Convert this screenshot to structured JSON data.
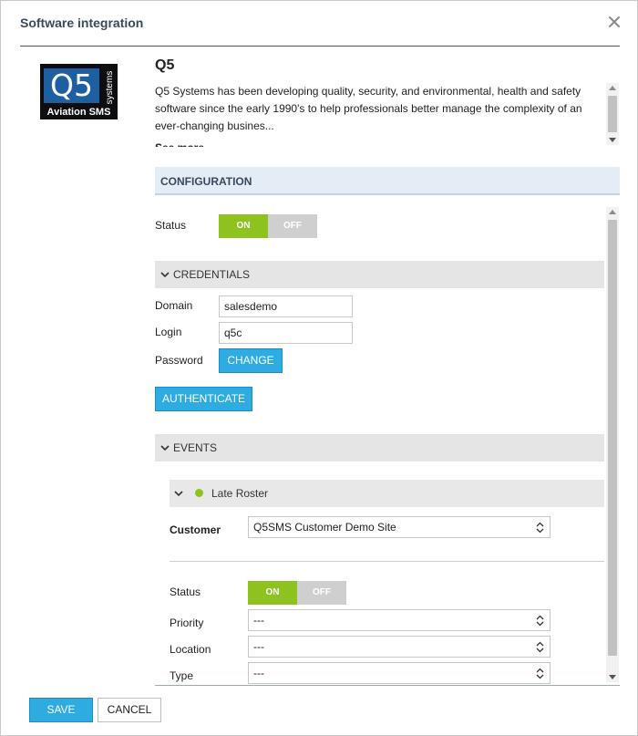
{
  "dialog": {
    "title": "Software integration"
  },
  "app": {
    "logo_text": "Q5",
    "logo_subtext": "systems",
    "logo_tagline": "Aviation SMS",
    "name": "Q5",
    "description": "Q5 Systems has been developing quality, security, and environmental, health and safety software since the early 1990's to help professionals better manage the complexity of an ever-changing busines...",
    "see_more": "See more"
  },
  "configuration": {
    "header": "CONFIGURATION",
    "status_label": "Status",
    "status_on": "ON",
    "status_off": "OFF",
    "status_value": "ON"
  },
  "credentials": {
    "header": "CREDENTIALS",
    "domain_label": "Domain",
    "domain_value": "salesdemo",
    "login_label": "Login",
    "login_value": "q5c",
    "password_label": "Password",
    "change_button": "CHANGE",
    "authenticate_button": "AUTHENTICATE"
  },
  "events": {
    "header": "EVENTS",
    "event_name": "Late Roster",
    "customer_label": "Customer",
    "customer_value": "Q5SMS Customer Demo Site",
    "status_label": "Status",
    "status_on": "ON",
    "status_off": "OFF",
    "priority_label": "Priority",
    "priority_value": "---",
    "location_label": "Location",
    "location_value": "---",
    "type_label": "Type",
    "type_value": "---"
  },
  "footer": {
    "save": "SAVE",
    "cancel": "CANCEL"
  },
  "colors": {
    "toggle_on": "#8dc21f",
    "primary_button": "#2eace2",
    "config_bar": "#e4ecf5"
  }
}
